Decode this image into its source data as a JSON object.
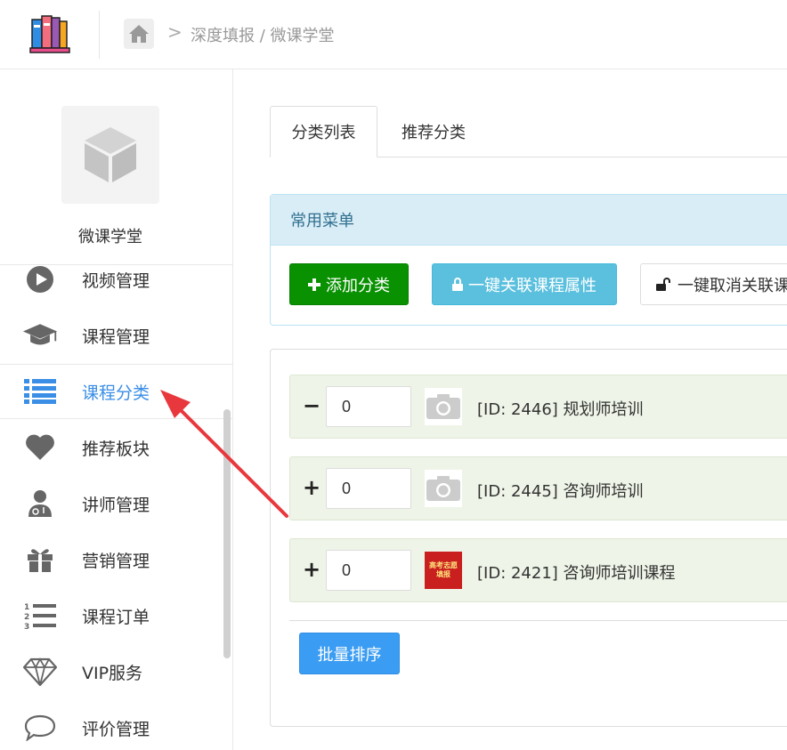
{
  "header": {
    "breadcrumb_sep": ">",
    "breadcrumb_text": "深度填报 / 微课学堂"
  },
  "sidebar": {
    "site_name": "微课学堂",
    "items": [
      {
        "label": "视频管理",
        "icon": "play-circle-icon"
      },
      {
        "label": "课程管理",
        "icon": "graduation-cap-icon"
      },
      {
        "label": "课程分类",
        "icon": "list-icon",
        "active": true
      },
      {
        "label": "推荐板块",
        "icon": "heart-icon"
      },
      {
        "label": "讲师管理",
        "icon": "user-md-icon"
      },
      {
        "label": "营销管理",
        "icon": "gift-icon"
      },
      {
        "label": "课程订单",
        "icon": "ordered-list-icon"
      },
      {
        "label": "VIP服务",
        "icon": "diamond-icon"
      },
      {
        "label": "评价管理",
        "icon": "comment-icon"
      }
    ]
  },
  "tabs": [
    {
      "label": "分类列表",
      "active": true
    },
    {
      "label": "推荐分类"
    }
  ],
  "common_menu": {
    "title": "常用菜单",
    "add_label": "添加分类",
    "link_label": "一键关联课程属性",
    "unlink_label": "一键取消关联课"
  },
  "category_rows": [
    {
      "toggle": "−",
      "sort": "0",
      "title": "[ID: 2446] 规划师培训",
      "thumb": "camera-icon"
    },
    {
      "toggle": "+",
      "sort": "0",
      "title": "[ID: 2445] 咨询师培训",
      "thumb": "camera-icon"
    },
    {
      "toggle": "+",
      "sort": "0",
      "title": "[ID: 2421] 咨询师培训课程",
      "thumb": "poster-image",
      "poster_lines": [
        "高考志愿",
        "填报"
      ]
    }
  ],
  "batch_sort_label": "批量排序",
  "colors": {
    "active_blue": "#3a8ee6",
    "green": "#099102",
    "info": "#5bc0de",
    "primary": "#3a9cf2",
    "annotation_arrow": "#e8383d"
  }
}
